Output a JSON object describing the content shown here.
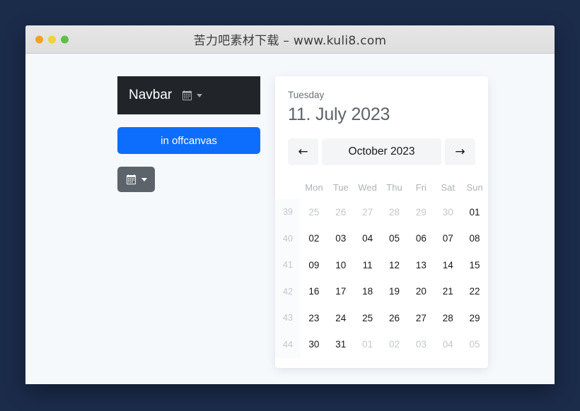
{
  "window": {
    "title": "苦力吧素材下载 – www.kuli8.com",
    "traffic_lights": [
      "close",
      "minimize",
      "maximize"
    ]
  },
  "navbar": {
    "brand": "Navbar",
    "dropdown_icon": "calendar-icon",
    "caret_icon": "caret-down-icon"
  },
  "buttons": {
    "offcanvas_label": "in offcanvas",
    "secondary_icon": "calendar-icon",
    "secondary_caret": "caret-down-icon"
  },
  "calendar": {
    "weekday_label": "Tuesday",
    "date_label": "11. July 2023",
    "prev_label": "←",
    "next_label": "→",
    "month_label": "October 2023",
    "weekday_headers": [
      "Mon",
      "Tue",
      "Wed",
      "Thu",
      "Fri",
      "Sat",
      "Sun"
    ],
    "week_numbers": [
      "39",
      "40",
      "41",
      "42",
      "43",
      "44"
    ],
    "weeks": [
      [
        {
          "d": "25",
          "muted": true
        },
        {
          "d": "26",
          "muted": true
        },
        {
          "d": "27",
          "muted": true
        },
        {
          "d": "28",
          "muted": true
        },
        {
          "d": "29",
          "muted": true
        },
        {
          "d": "30",
          "muted": true
        },
        {
          "d": "01",
          "muted": false
        }
      ],
      [
        {
          "d": "02",
          "muted": false
        },
        {
          "d": "03",
          "muted": false
        },
        {
          "d": "04",
          "muted": false
        },
        {
          "d": "05",
          "muted": false
        },
        {
          "d": "06",
          "muted": false
        },
        {
          "d": "07",
          "muted": false
        },
        {
          "d": "08",
          "muted": false
        }
      ],
      [
        {
          "d": "09",
          "muted": false
        },
        {
          "d": "10",
          "muted": false
        },
        {
          "d": "11",
          "muted": false
        },
        {
          "d": "12",
          "muted": false
        },
        {
          "d": "13",
          "muted": false
        },
        {
          "d": "14",
          "muted": false
        },
        {
          "d": "15",
          "muted": false
        }
      ],
      [
        {
          "d": "16",
          "muted": false
        },
        {
          "d": "17",
          "muted": false
        },
        {
          "d": "18",
          "muted": false
        },
        {
          "d": "19",
          "muted": false
        },
        {
          "d": "20",
          "muted": false
        },
        {
          "d": "21",
          "muted": false
        },
        {
          "d": "22",
          "muted": false
        }
      ],
      [
        {
          "d": "23",
          "muted": false
        },
        {
          "d": "24",
          "muted": false
        },
        {
          "d": "25",
          "muted": false
        },
        {
          "d": "26",
          "muted": false
        },
        {
          "d": "27",
          "muted": false
        },
        {
          "d": "28",
          "muted": false
        },
        {
          "d": "29",
          "muted": false
        }
      ],
      [
        {
          "d": "30",
          "muted": false
        },
        {
          "d": "31",
          "muted": false
        },
        {
          "d": "01",
          "muted": true
        },
        {
          "d": "02",
          "muted": true
        },
        {
          "d": "03",
          "muted": true
        },
        {
          "d": "04",
          "muted": true
        },
        {
          "d": "05",
          "muted": true
        }
      ]
    ]
  },
  "colors": {
    "page_background": "#1b2b4a",
    "navbar_dark": "#212529",
    "primary_blue": "#0d6efd",
    "secondary_gray": "#5c636a",
    "card_white": "#ffffff"
  }
}
